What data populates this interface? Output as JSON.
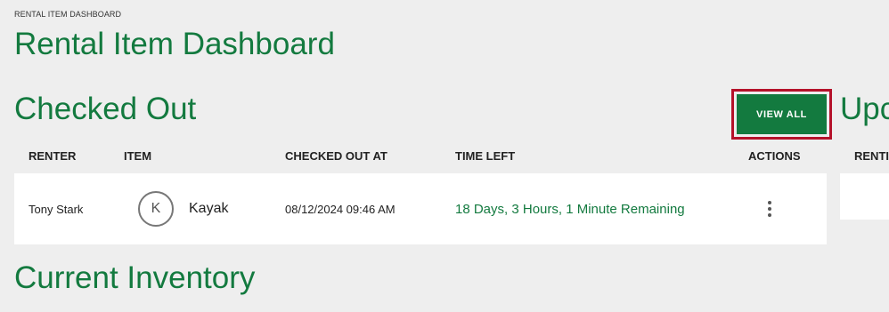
{
  "breadcrumb": "RENTAL ITEM DASHBOARD",
  "page_title": "Rental Item Dashboard",
  "checked_out": {
    "title": "Checked Out",
    "view_all_label": "VIEW ALL",
    "columns": {
      "renter": "RENTER",
      "item": "ITEM",
      "checked_out_at": "CHECKED OUT AT",
      "time_left": "TIME LEFT",
      "actions": "ACTIONS"
    },
    "rows": [
      {
        "renter": "Tony Stark",
        "item_initial": "K",
        "item": "Kayak",
        "checked_out_at": "08/12/2024 09:46 AM",
        "time_left": "18 Days, 3 Hours, 1 Minute Remaining",
        "actions_icon": "kebab-menu-icon"
      }
    ]
  },
  "upcoming": {
    "title": "Upc",
    "columns": {
      "renter": "RENTI"
    }
  },
  "inventory": {
    "title": "Current Inventory"
  },
  "colors": {
    "accent": "#137a3f",
    "highlight_border": "#b5122a",
    "background": "#eeeeee"
  }
}
